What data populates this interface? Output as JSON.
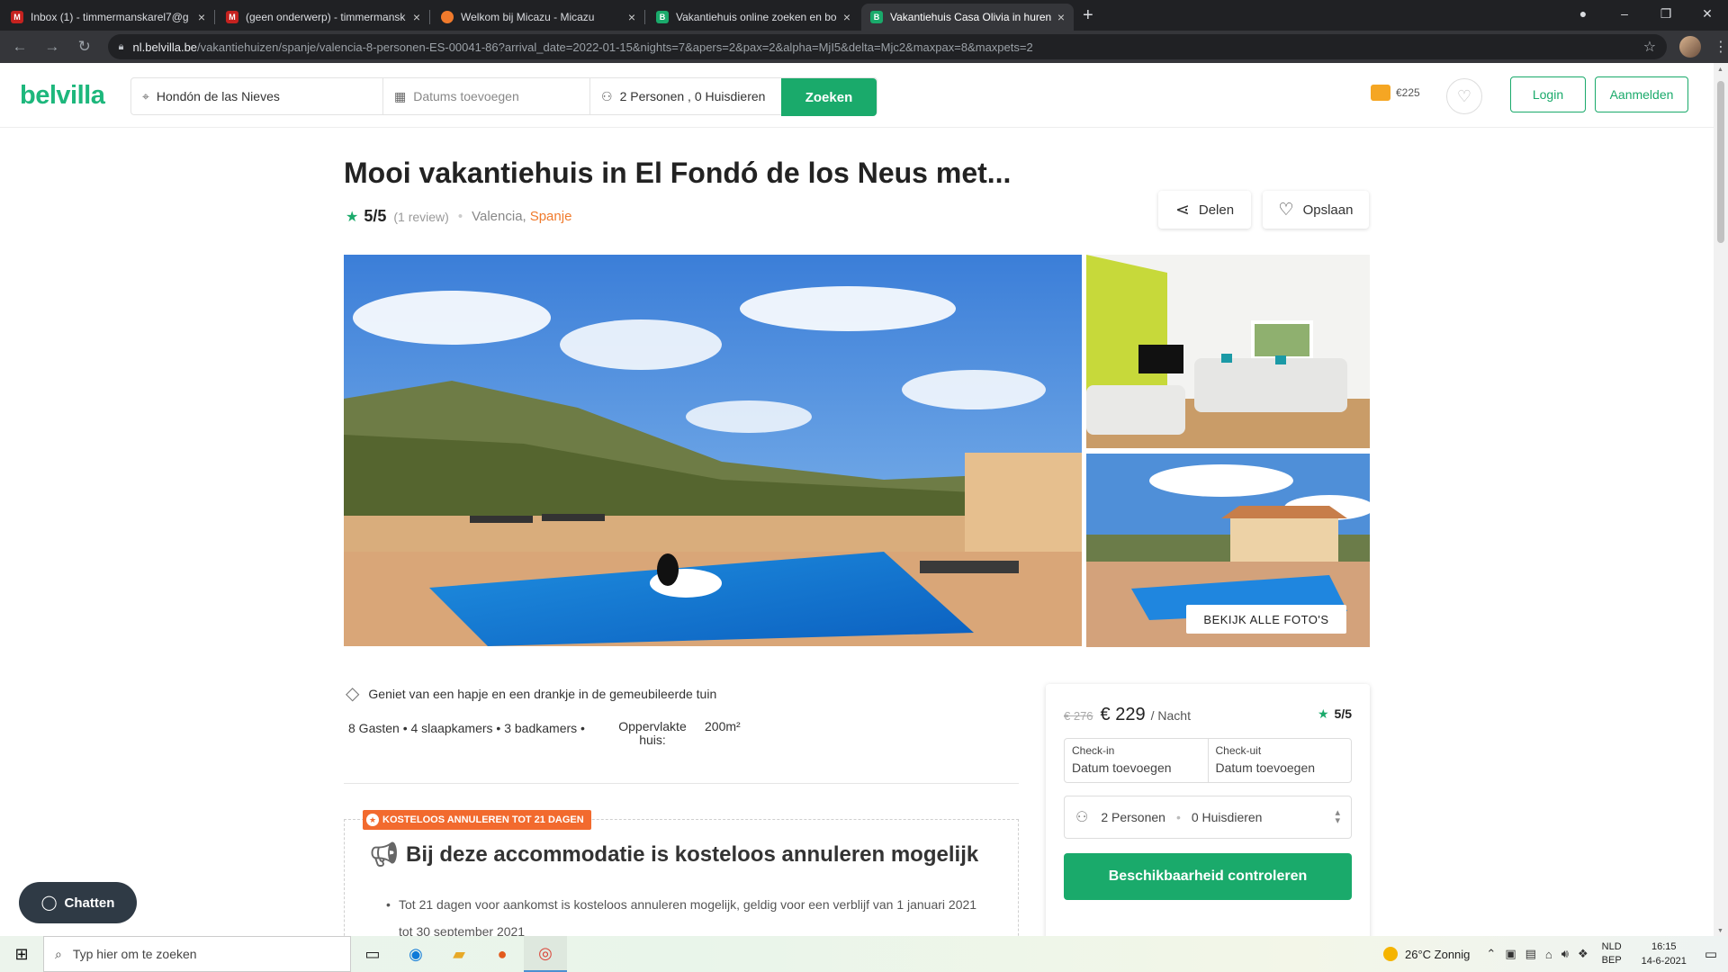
{
  "browser": {
    "tabs": [
      {
        "title": "Inbox (1) - timmermanskarel7@g",
        "favicon": "gmail-icon",
        "color": "#c5221f",
        "active": false
      },
      {
        "title": "(geen onderwerp) - timmermansk",
        "favicon": "gmail-icon",
        "color": "#c5221f",
        "active": false
      },
      {
        "title": "Welkom bij Micazu - Micazu",
        "favicon": "micazu-icon",
        "color": "#f07a2c",
        "active": false
      },
      {
        "title": "Vakantiehuis online zoeken en bo",
        "favicon": "belvilla-icon",
        "color": "#1aaa6b",
        "active": false
      },
      {
        "title": "Vakantiehuis Casa Olivia in huren",
        "favicon": "belvilla-icon",
        "color": "#1aaa6b",
        "active": true
      }
    ],
    "url_host": "nl.belvilla.be",
    "url_path": "/vakantiehuizen/spanje/valencia-8-personen-ES-00041-86?arrival_date=2022-01-15&nights=7&apers=2&pax=2&alpha=MjI5&delta=Mjc2&maxpax=8&maxpets=2"
  },
  "header": {
    "logo": "belvilla",
    "destination": "Hondón de las Nieves",
    "dates_placeholder": "Datums toevoegen",
    "guests": "2 Personen , 0 Huisdieren",
    "search_label": "Zoeken",
    "wallet_amount": "€225",
    "login_label": "Login",
    "register_label": "Aanmelden"
  },
  "listing": {
    "title": "Mooi vakantiehuis in El Fondó de los Neus met...",
    "rating": "5/5",
    "reviews": "(1 review)",
    "region": "Valencia,",
    "country": "Spanje",
    "share_label": "Delen",
    "save_label": "Opslaan",
    "all_photos_label": "BEKIJK ALLE FOTO'S",
    "highlight": "Geniet van een hapje en een drankje in de gemeubileerde tuin",
    "facts": "8 Gasten • 4 slaapkamers • 3 badkamers •",
    "area_label": "Oppervlakte huis:",
    "area_value": "200m²"
  },
  "cancellation": {
    "badge": "KOSTELOOS ANNULEREN TOT 21 DAGEN",
    "title": "Bij deze accommodatie is kosteloos annuleren mogelijk",
    "text": "Tot 21 dagen voor aankomst is kosteloos annuleren mogelijk, geldig voor een verblijf van 1 januari 2021 tot 30 september 2021"
  },
  "booking": {
    "old_price": "€ 276",
    "price": "€ 229",
    "per_night": "/ Nacht",
    "rating": "5/5",
    "checkin_label": "Check-in",
    "checkin_value": "Datum toevoegen",
    "checkout_label": "Check-uit",
    "checkout_value": "Datum toevoegen",
    "persons": "2 Personen",
    "pets": "0 Huisdieren",
    "check_label": "Beschikbaarheid controleren"
  },
  "chat_label": "Chatten",
  "taskbar": {
    "search_placeholder": "Typ hier om te zoeken",
    "weather": "26°C  Zonnig",
    "lang_1": "NLD",
    "lang_2": "BEP",
    "time": "16:15",
    "date": "14-6-2021"
  },
  "colors": {
    "brand": "#1aaa6b",
    "accent": "#f26a2e"
  }
}
